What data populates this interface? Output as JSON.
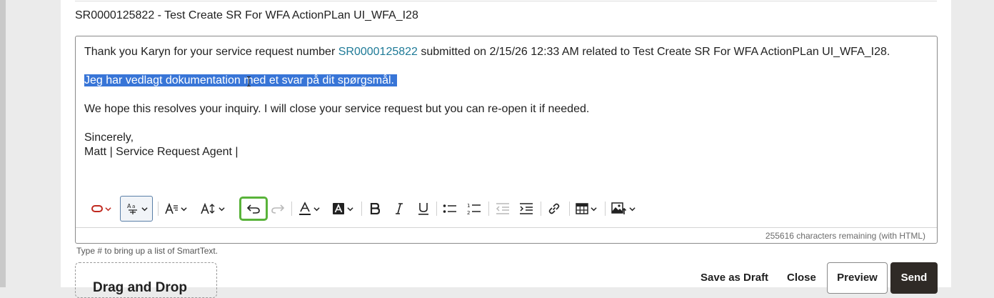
{
  "subject": "SR0000125822 - Test Create SR For WFA ActionPLan UI_WFA_I28",
  "message": {
    "line1_prefix": "Thank you Karyn for your service request number ",
    "line1_link": "SR0000125822",
    "line1_suffix": " submitted on 2/15/26 12:33 AM related to Test Create SR For WFA ActionPLan UI_WFA_I28.",
    "selected_line": "Jeg har vedlagt dokumentation med et svar på dit spørgsmål.",
    "line3": "We hope this resolves your inquiry. I will close your service request but you can re-open it if needed.",
    "closing": "Sincerely,",
    "signature": "Matt | Service Request Agent |"
  },
  "colors": {
    "link": "#1e7a97",
    "selection": "#3875d7",
    "highlight_box": "#59b33a",
    "send_button": "#2f2a26"
  },
  "toolbar": {
    "icons": [
      "text-style-icon",
      "translate-icon",
      "paragraph-format-icon",
      "font-size-icon",
      "undo-icon",
      "redo-icon",
      "font-color-icon",
      "background-color-icon",
      "bold-icon",
      "italic-icon",
      "underline-icon",
      "bulleted-list-icon",
      "numbered-list-icon",
      "decrease-indent-icon",
      "increase-indent-icon",
      "link-icon",
      "table-icon",
      "insert-image-icon"
    ],
    "highlighted": "undo-icon"
  },
  "char_count": "255616 characters remaining (with HTML)",
  "smarttext_hint": "Type # to bring up a list of SmartText.",
  "dropzone_label": "Drag and Drop",
  "actions": {
    "save_draft": "Save as Draft",
    "close": "Close",
    "preview": "Preview",
    "send": "Send"
  }
}
